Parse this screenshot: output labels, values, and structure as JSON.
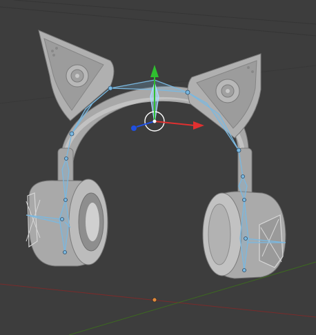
{
  "viewport": {
    "background_color": "#3d3d3d",
    "grid_line_color": "#353535",
    "x_axis_color": "#7a2b2b",
    "y_axis_color": "#3d6b1f",
    "world_origin_color": "#e08a3a"
  },
  "model": {
    "object": "cat-ear-headphones",
    "mesh_color": "#b8b8b8",
    "mesh_shadow_color": "#8a8a8a",
    "mesh_highlight_color": "#d4d4d4"
  },
  "armature": {
    "color": "#7ab8e0",
    "selected_color": "#a8dcff"
  },
  "gizmo": {
    "x_color": "#e03030",
    "y_color": "#2fbf2f",
    "z_color": "#2050e0",
    "ring_color": "#ffffff"
  }
}
